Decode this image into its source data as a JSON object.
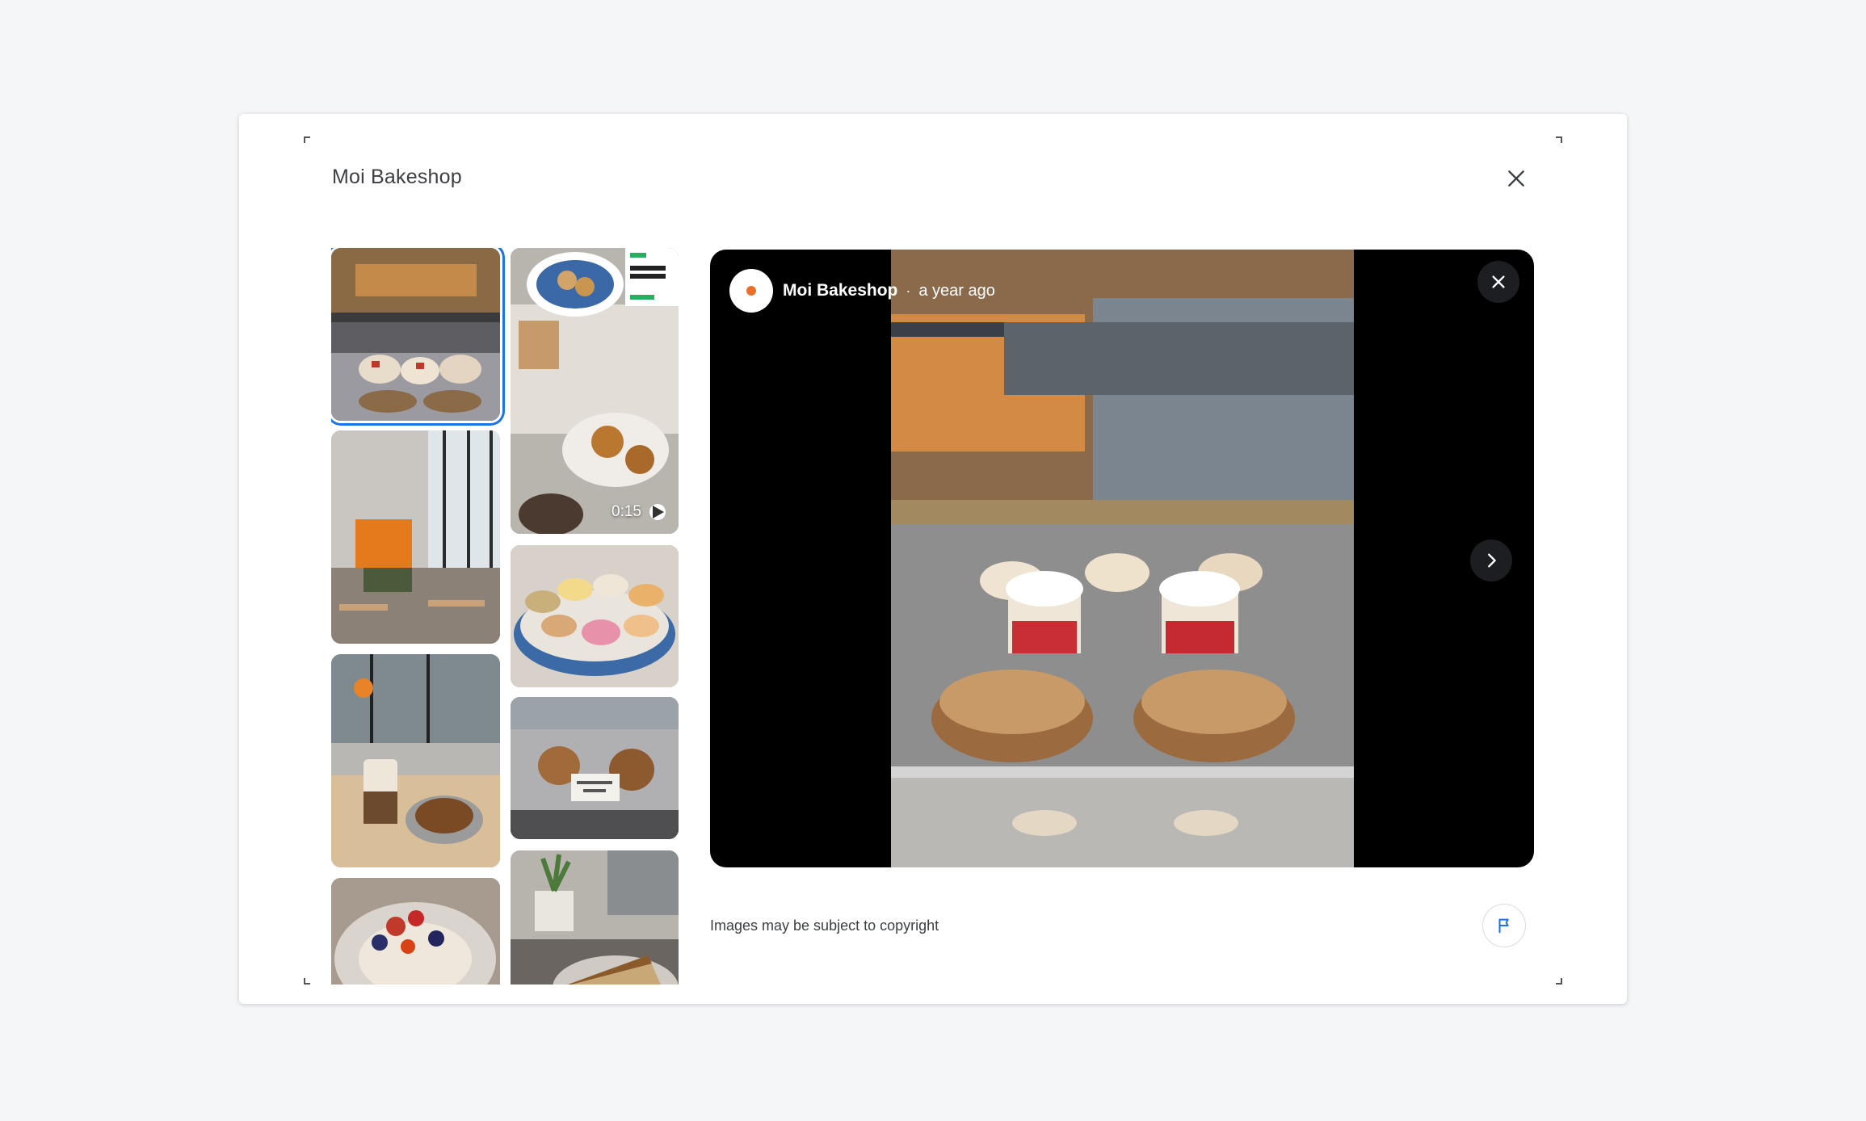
{
  "dialog": {
    "title": "Moi Bakeshop",
    "close_icon": "close-icon"
  },
  "thumbnails": [
    {
      "subject": "pastry display case",
      "selected": true
    },
    {
      "subject": "bakery interior"
    },
    {
      "subject": "coffee and pastry at window"
    },
    {
      "subject": "berry tart"
    },
    {
      "subject": "cookies and donuts on plates",
      "video_duration": "0:15"
    },
    {
      "subject": "macarons on cake stand"
    },
    {
      "subject": "display case with label"
    },
    {
      "subject": "cheesecake slice and plant"
    }
  ],
  "viewer": {
    "author": "Moi Bakeshop",
    "separator": "·",
    "time_ago": "a year ago",
    "close_icon": "close-icon",
    "next_icon": "chevron-right-icon"
  },
  "footer": {
    "copyright_notice": "Images may be subject to copyright",
    "report_icon": "flag-icon"
  },
  "colors": {
    "accent": "#1a73e8",
    "viewer_bg": "#000000",
    "page_bg": "#f5f6f8"
  }
}
